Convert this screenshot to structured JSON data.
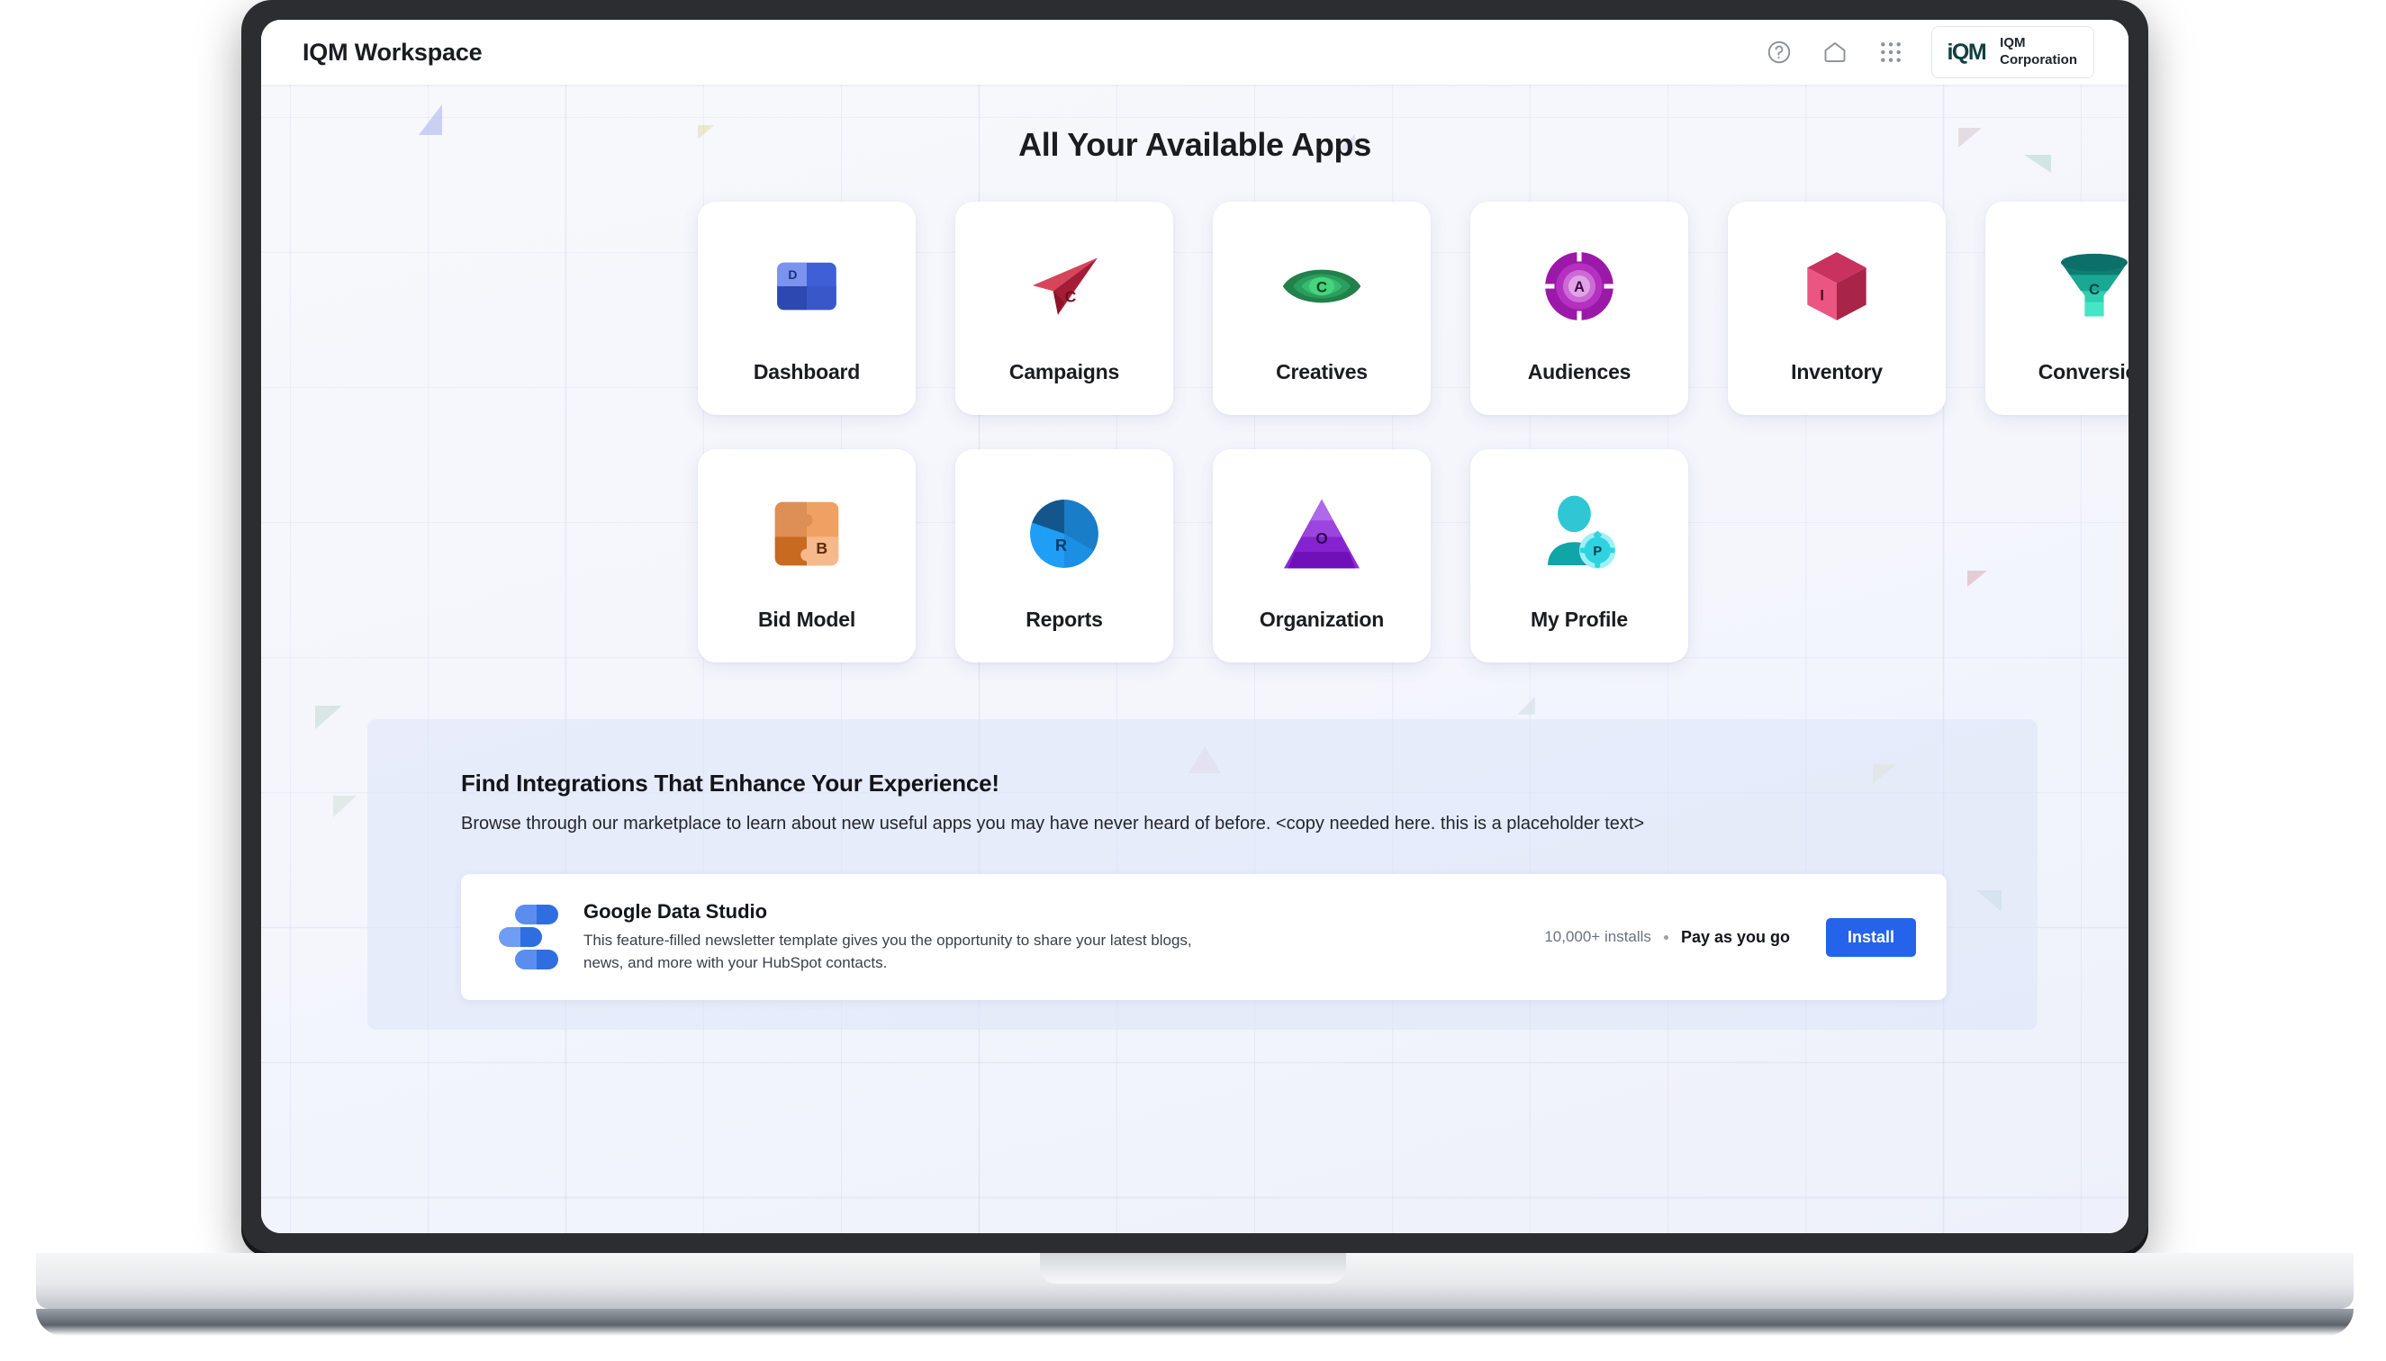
{
  "header": {
    "workspace_title": "IQM Workspace",
    "icons": [
      {
        "name": "help-icon",
        "glyph": "?"
      },
      {
        "name": "home-icon",
        "glyph": "home"
      },
      {
        "name": "apps-grid-icon",
        "glyph": "grid"
      }
    ],
    "org": {
      "logo_text": "iQM",
      "name_line1": "IQM",
      "name_line2": "Corporation",
      "logo_color": "#11403f"
    }
  },
  "main": {
    "title": "All Your Available Apps",
    "apps": [
      {
        "label": "Dashboard",
        "icon": "dashboard-quadrant-icon",
        "letter": "D",
        "color": "#3f5fd6"
      },
      {
        "label": "Campaigns",
        "icon": "paper-plane-icon",
        "letter": "C",
        "color": "#cf2744"
      },
      {
        "label": "Creatives",
        "icon": "eye-icon",
        "letter": "C",
        "color": "#1f9d55"
      },
      {
        "label": "Audiences",
        "icon": "target-circle-icon",
        "letter": "A",
        "color": "#9b18a8"
      },
      {
        "label": "Inventory",
        "icon": "cube-icon",
        "letter": "I",
        "color": "#e4406f"
      },
      {
        "label": "Conversion",
        "icon": "funnel-icon",
        "letter": "C",
        "color": "#16a394"
      },
      {
        "label": "Bid Model",
        "icon": "puzzle-piece-icon",
        "letter": "B",
        "color": "#e8833a"
      },
      {
        "label": "Reports",
        "icon": "pie-chart-icon",
        "letter": "R",
        "color": "#1a8fe3"
      },
      {
        "label": "Organization",
        "icon": "pyramid-icon",
        "letter": "O",
        "color": "#8b2bd6"
      },
      {
        "label": "My Profile",
        "icon": "person-gear-icon",
        "letter": "P",
        "color": "#1fb6c1"
      }
    ]
  },
  "integrations": {
    "title": "Find Integrations That Enhance Your Experience!",
    "subtitle": "Browse through our marketplace to learn about new useful apps you may have never heard of before.  <copy needed here. this is a placeholder text>",
    "card": {
      "logo_name": "google-data-studio-logo",
      "name": "Google Data Studio",
      "description": "This feature-filled newsletter template gives you the opportunity to share your latest blogs, news, and more with your HubSpot contacts.",
      "installs": "10,000+ installs",
      "pricing": "Pay as you go",
      "install_label": "Install",
      "install_color": "#2563eb"
    }
  }
}
